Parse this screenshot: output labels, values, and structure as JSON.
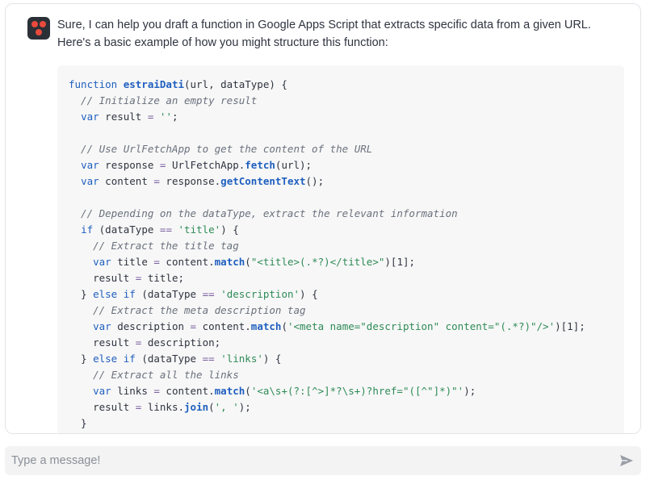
{
  "message": {
    "intro_text": "Sure, I can help you draft a function in Google Apps Script that extracts specific data from a given URL. Here's a basic example of how you might structure this function:",
    "code_lines": [
      [
        {
          "t": "function ",
          "c": "kw"
        },
        {
          "t": "estraiDati",
          "c": "fn"
        },
        {
          "t": "(url, dataType) {",
          "c": ""
        }
      ],
      [
        {
          "t": "  // Initialize an empty result",
          "c": "cm"
        }
      ],
      [
        {
          "t": "  ",
          "c": ""
        },
        {
          "t": "var",
          "c": "kw"
        },
        {
          "t": " result ",
          "c": ""
        },
        {
          "t": "=",
          "c": "op"
        },
        {
          "t": " ",
          "c": ""
        },
        {
          "t": "''",
          "c": "st"
        },
        {
          "t": ";",
          "c": ""
        }
      ],
      [
        {
          "t": "",
          "c": ""
        }
      ],
      [
        {
          "t": "  // Use UrlFetchApp to get the content of the URL",
          "c": "cm"
        }
      ],
      [
        {
          "t": "  ",
          "c": ""
        },
        {
          "t": "var",
          "c": "kw"
        },
        {
          "t": " response ",
          "c": ""
        },
        {
          "t": "=",
          "c": "op"
        },
        {
          "t": " UrlFetchApp.",
          "c": ""
        },
        {
          "t": "fetch",
          "c": "fn"
        },
        {
          "t": "(url);",
          "c": ""
        }
      ],
      [
        {
          "t": "  ",
          "c": ""
        },
        {
          "t": "var",
          "c": "kw"
        },
        {
          "t": " content ",
          "c": ""
        },
        {
          "t": "=",
          "c": "op"
        },
        {
          "t": " response.",
          "c": ""
        },
        {
          "t": "getContentText",
          "c": "fn"
        },
        {
          "t": "();",
          "c": ""
        }
      ],
      [
        {
          "t": "",
          "c": ""
        }
      ],
      [
        {
          "t": "  // Depending on the dataType, extract the relevant information",
          "c": "cm"
        }
      ],
      [
        {
          "t": "  ",
          "c": ""
        },
        {
          "t": "if",
          "c": "kw"
        },
        {
          "t": " (dataType ",
          "c": ""
        },
        {
          "t": "==",
          "c": "op"
        },
        {
          "t": " ",
          "c": ""
        },
        {
          "t": "'title'",
          "c": "st"
        },
        {
          "t": ") {",
          "c": ""
        }
      ],
      [
        {
          "t": "    // Extract the title tag",
          "c": "cm"
        }
      ],
      [
        {
          "t": "    ",
          "c": ""
        },
        {
          "t": "var",
          "c": "kw"
        },
        {
          "t": " title ",
          "c": ""
        },
        {
          "t": "=",
          "c": "op"
        },
        {
          "t": " content.",
          "c": ""
        },
        {
          "t": "match",
          "c": "fn"
        },
        {
          "t": "(",
          "c": ""
        },
        {
          "t": "\"<title>(.*?)</title>\"",
          "c": "st"
        },
        {
          "t": ")[1];",
          "c": ""
        }
      ],
      [
        {
          "t": "    result ",
          "c": ""
        },
        {
          "t": "=",
          "c": "op"
        },
        {
          "t": " title;",
          "c": ""
        }
      ],
      [
        {
          "t": "  } ",
          "c": ""
        },
        {
          "t": "else if",
          "c": "kw"
        },
        {
          "t": " (dataType ",
          "c": ""
        },
        {
          "t": "==",
          "c": "op"
        },
        {
          "t": " ",
          "c": ""
        },
        {
          "t": "'description'",
          "c": "st"
        },
        {
          "t": ") {",
          "c": ""
        }
      ],
      [
        {
          "t": "    // Extract the meta description tag",
          "c": "cm"
        }
      ],
      [
        {
          "t": "    ",
          "c": ""
        },
        {
          "t": "var",
          "c": "kw"
        },
        {
          "t": " description ",
          "c": ""
        },
        {
          "t": "=",
          "c": "op"
        },
        {
          "t": " content.",
          "c": ""
        },
        {
          "t": "match",
          "c": "fn"
        },
        {
          "t": "(",
          "c": ""
        },
        {
          "t": "'<meta name=\"description\" content=\"(.*?)\"/>'",
          "c": "st"
        },
        {
          "t": ")[1];",
          "c": ""
        }
      ],
      [
        {
          "t": "    result ",
          "c": ""
        },
        {
          "t": "=",
          "c": "op"
        },
        {
          "t": " description;",
          "c": ""
        }
      ],
      [
        {
          "t": "  } ",
          "c": ""
        },
        {
          "t": "else if",
          "c": "kw"
        },
        {
          "t": " (dataType ",
          "c": ""
        },
        {
          "t": "==",
          "c": "op"
        },
        {
          "t": " ",
          "c": ""
        },
        {
          "t": "'links'",
          "c": "st"
        },
        {
          "t": ") {",
          "c": ""
        }
      ],
      [
        {
          "t": "    // Extract all the links",
          "c": "cm"
        }
      ],
      [
        {
          "t": "    ",
          "c": ""
        },
        {
          "t": "var",
          "c": "kw"
        },
        {
          "t": " links ",
          "c": ""
        },
        {
          "t": "=",
          "c": "op"
        },
        {
          "t": " content.",
          "c": ""
        },
        {
          "t": "match",
          "c": "fn"
        },
        {
          "t": "(",
          "c": ""
        },
        {
          "t": "'<a\\s+(?:[^>]*?\\s+)?href=\"([^\"]*)\"'",
          "c": "st"
        },
        {
          "t": ");",
          "c": ""
        }
      ],
      [
        {
          "t": "    result ",
          "c": ""
        },
        {
          "t": "=",
          "c": "op"
        },
        {
          "t": " links.",
          "c": ""
        },
        {
          "t": "join",
          "c": "fn"
        },
        {
          "t": "(",
          "c": ""
        },
        {
          "t": "', '",
          "c": "st"
        },
        {
          "t": ");",
          "c": ""
        }
      ],
      [
        {
          "t": "  }",
          "c": ""
        }
      ]
    ]
  },
  "composer": {
    "placeholder": "Type a message!",
    "send_icon": "send-icon"
  },
  "colors": {
    "keyword": "#1f5fbf",
    "comment": "#6a717d",
    "string": "#2e8b57",
    "code_background": "#f7f7f7",
    "avatar_accent": "#e84a3c"
  }
}
